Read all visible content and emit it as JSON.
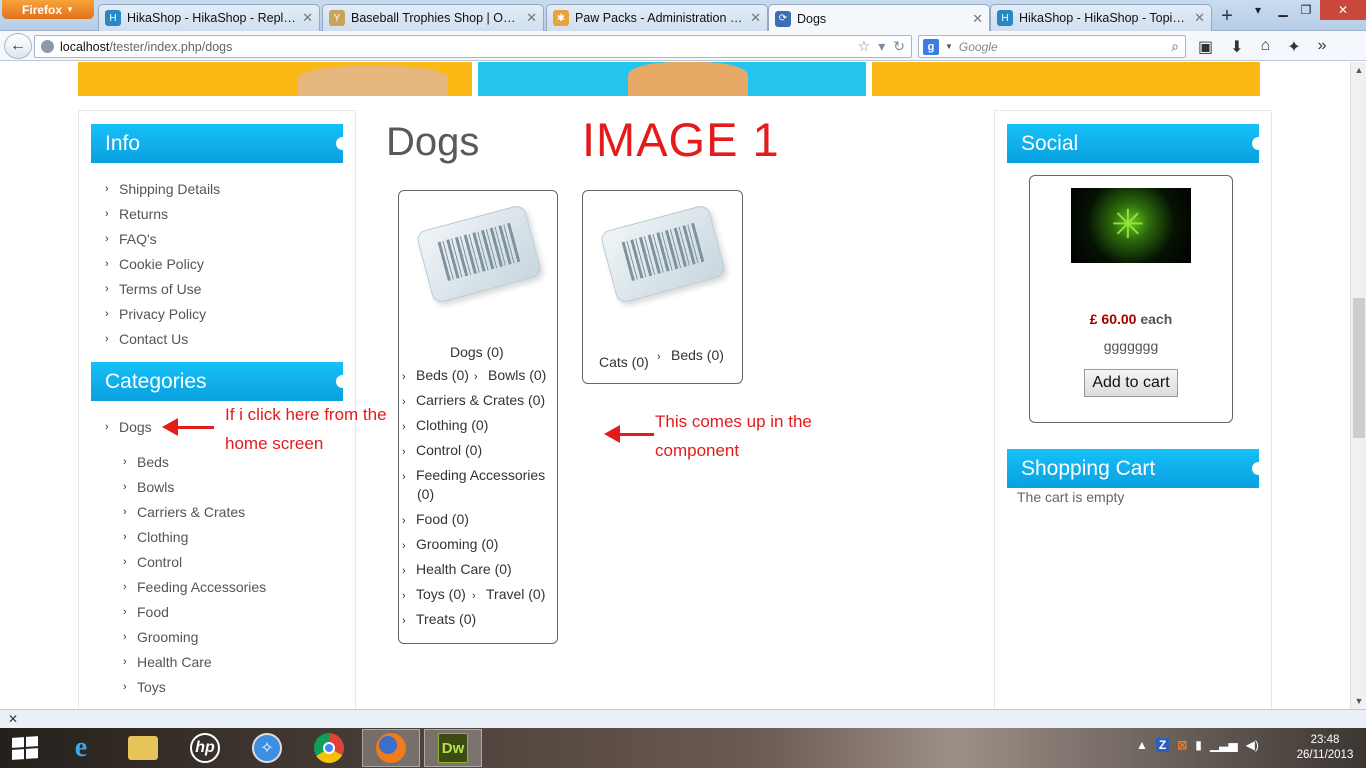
{
  "browser": {
    "firefox_button": "Firefox",
    "tabs": [
      {
        "label": "HikaShop - HikaShop - Reply To...",
        "favicon_color": "#2a87c5",
        "active": false
      },
      {
        "label": "Baseball Trophies Shop | Online ...",
        "favicon_color": "#c8a35a",
        "active": false
      },
      {
        "label": "Paw Packs - Administration - Ca...",
        "favicon_color": "#e7a33a",
        "active": false
      },
      {
        "label": "Dogs",
        "favicon_color": "#3a6fb5",
        "active": true
      },
      {
        "label": "HikaShop - HikaShop - Topic: ...",
        "favicon_color": "#2a87c5",
        "active": false
      }
    ],
    "url_host": "localhost",
    "url_path": "/tester/index.php/dogs",
    "search_placeholder": "Google"
  },
  "left_sidebar": {
    "info_title": "Info",
    "info_links": [
      "Shipping Details",
      "Returns",
      "FAQ's",
      "Cookie Policy",
      "Terms of Use",
      "Privacy Policy",
      "Contact Us"
    ],
    "categories_title": "Categories",
    "category_top": "Dogs",
    "subcategories": [
      "Beds",
      "Bowls",
      "Carriers & Crates",
      "Clothing",
      "Control",
      "Feeding Accessories",
      "Food",
      "Grooming",
      "Health Care",
      "Toys"
    ]
  },
  "main": {
    "title": "Dogs",
    "annotation_image": "IMAGE 1",
    "annotation_left": "If i click here from the home screen",
    "annotation_right": "This comes up in the component",
    "box1": {
      "heading": "Dogs (0)",
      "links": {
        "beds": "Beds (0)",
        "bowls": "Bowls (0)",
        "carriers": "Carriers & Crates (0)",
        "clothing": "Clothing (0)",
        "control": "Control (0)",
        "feeding": "Feeding Accessories",
        "feeding_count": "(0)",
        "food": "Food (0)",
        "grooming": "Grooming (0)",
        "health": "Health Care (0)",
        "toys": "Toys (0)",
        "travel": "Travel (0)",
        "treats": "Treats (0)"
      }
    },
    "box2": {
      "heading": "Cats (0)",
      "beds": "Beds (0)"
    }
  },
  "right_sidebar": {
    "social_title": "Social",
    "product": {
      "price": "£ 60.00",
      "price_unit": "each",
      "name": "ggggggg",
      "button": "Add to cart"
    },
    "cart_title": "Shopping Cart",
    "cart_status": "The cart is empty"
  },
  "taskbar": {
    "time": "23:48",
    "date": "26/11/2013"
  },
  "colors": {
    "module_header": "#0aa0e0",
    "annotation": "#e31b1b",
    "price": "#a30000",
    "banner_yellow": "#fdb913",
    "banner_blue": "#27c4f0"
  }
}
